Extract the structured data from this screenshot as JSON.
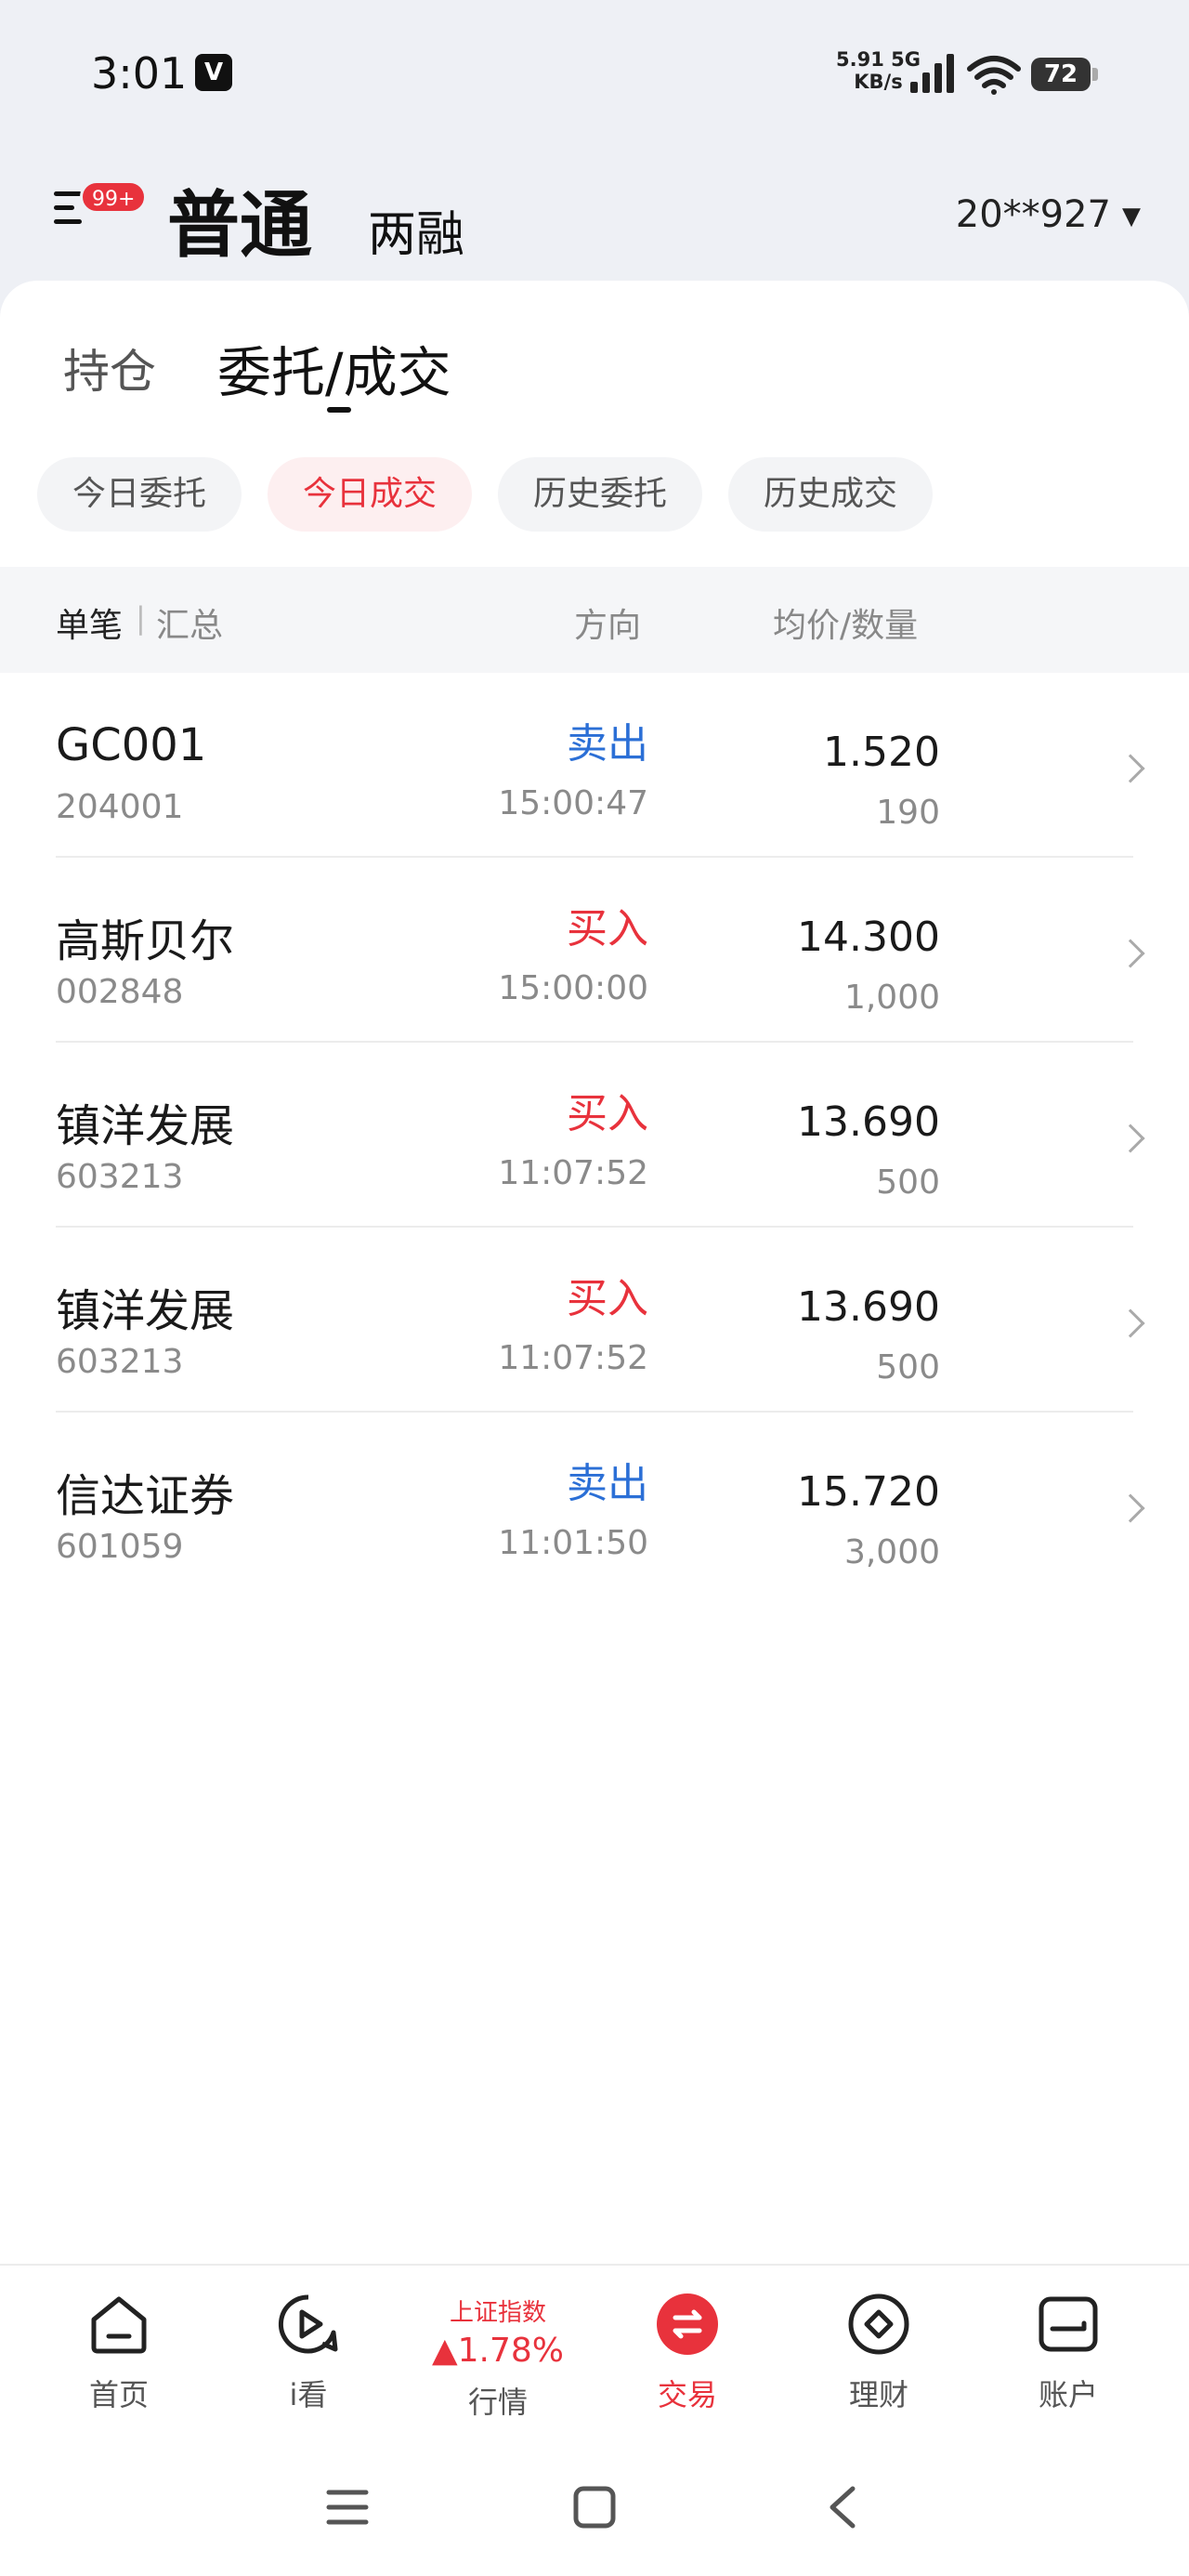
{
  "status_bar": {
    "time": "3:01",
    "v_badge": "V",
    "net_speed_top": "5.91 5G",
    "net_speed_bottom": "KB/s",
    "battery": "72"
  },
  "header": {
    "badge": "99+",
    "tab_normal": "普通",
    "tab_margin": "两融",
    "account": "20**927"
  },
  "subtabs": {
    "holdings": "持仓",
    "orders_a": "委托",
    "orders_sep": "/",
    "orders_b": "成交"
  },
  "chips": [
    "今日委托",
    "今日成交",
    "历史委托",
    "历史成交"
  ],
  "active_chip": 1,
  "table_header": {
    "single": "单笔",
    "sep": "|",
    "summary": "汇总",
    "direction": "方向",
    "price_qty": "均价/数量"
  },
  "rows": [
    {
      "name": "GC001",
      "code": "204001",
      "direction": "卖出",
      "side": "sell",
      "time": "15:00:47",
      "price": "1.520",
      "qty": "190"
    },
    {
      "name": "高斯贝尔",
      "code": "002848",
      "direction": "买入",
      "side": "buy",
      "time": "15:00:00",
      "price": "14.300",
      "qty": "1,000"
    },
    {
      "name": "镇洋发展",
      "code": "603213",
      "direction": "买入",
      "side": "buy",
      "time": "11:07:52",
      "price": "13.690",
      "qty": "500"
    },
    {
      "name": "镇洋发展",
      "code": "603213",
      "direction": "买入",
      "side": "buy",
      "time": "11:07:52",
      "price": "13.690",
      "qty": "500"
    },
    {
      "name": "信达证券",
      "code": "601059",
      "direction": "卖出",
      "side": "sell",
      "time": "11:01:50",
      "price": "15.720",
      "qty": "3,000"
    }
  ],
  "bottom_nav": {
    "home": "首页",
    "watch": "i看",
    "market_index_name": "上证指数",
    "market_index_value": "▲1.78%",
    "market": "行情",
    "trade": "交易",
    "wealth": "理财",
    "account": "账户"
  },
  "colors": {
    "accent_red": "#e8323c",
    "sell_blue": "#2b6fd6"
  }
}
